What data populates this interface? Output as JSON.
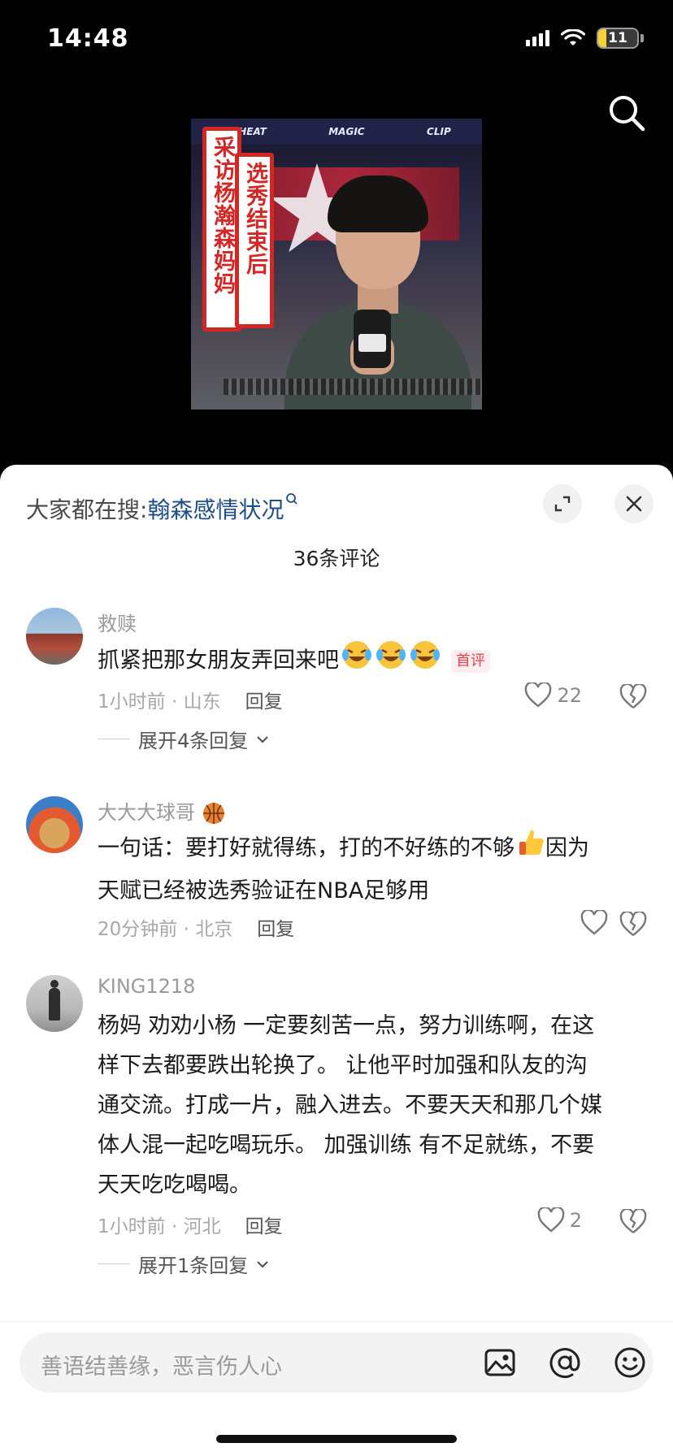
{
  "status": {
    "time": "14:48",
    "battery": "11"
  },
  "video": {
    "title_col1": "采访杨瀚森妈妈",
    "title_col2": "选秀结束后",
    "arena_logos": [
      "HEAT",
      "MAGIC",
      "CLIP"
    ]
  },
  "sheet": {
    "trending_prefix": "大家都在搜:",
    "trending_keyword": "翰森感情状况",
    "comment_count": "36条评论"
  },
  "comments": [
    {
      "user": "救赎",
      "text": "抓紧把那女朋友弄回来吧",
      "emojis": 3,
      "badge": "首评",
      "time_loc": "1小时前 · 山东",
      "reply": "回复",
      "likes": "22",
      "expand": "展开4条回复"
    },
    {
      "user": "大大大球哥",
      "text_line1": "一句话：要打好就得练，打的不好练的不够",
      "text_after_emoji": "因为",
      "text_line2": "天赋已经被选秀验证在NBA足够用",
      "time_loc": "20分钟前 · 北京",
      "reply": "回复",
      "likes": ""
    },
    {
      "user": "KING1218",
      "lines": [
        "杨妈 劝劝小杨 一定要刻苦一点，努力训练啊，在这",
        "样下去都要跌出轮换了。 让他平时加强和队友的沟",
        "通交流。打成一片，融入进去。不要天天和那几个媒",
        "体人混一起吃喝玩乐。 加强训练 有不足就练，不要",
        "天天吃吃喝喝。"
      ],
      "time_loc": "1小时前 · 河北",
      "reply": "回复",
      "likes": "2",
      "expand": "展开1条回复"
    }
  ],
  "input": {
    "placeholder": "善语结善缘，恶言伤人心"
  }
}
